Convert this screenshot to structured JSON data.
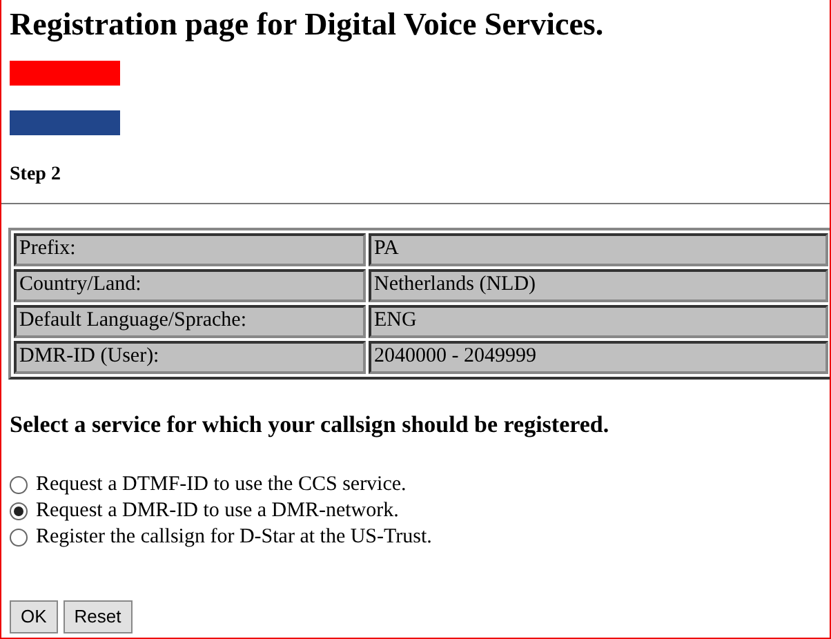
{
  "title": "Registration page for Digital Voice Services.",
  "step": "Step 2",
  "info_table": [
    {
      "label": "Prefix:",
      "value": "PA"
    },
    {
      "label": "Country/Land:",
      "value": "Netherlands (NLD)"
    },
    {
      "label": "Default Language/Sprache:",
      "value": "ENG"
    },
    {
      "label": "DMR-ID (User):",
      "value": "2040000 - 2049999"
    }
  ],
  "service_heading": "Select a service for which your callsign should be registered.",
  "services": [
    {
      "label": "Request a DTMF-ID to use the CCS service.",
      "selected": false
    },
    {
      "label": "Request a DMR-ID to use a DMR-network.",
      "selected": true
    },
    {
      "label": "Register the callsign for D-Star at the US-Trust.",
      "selected": false
    }
  ],
  "buttons": [
    "OK",
    "Reset"
  ]
}
